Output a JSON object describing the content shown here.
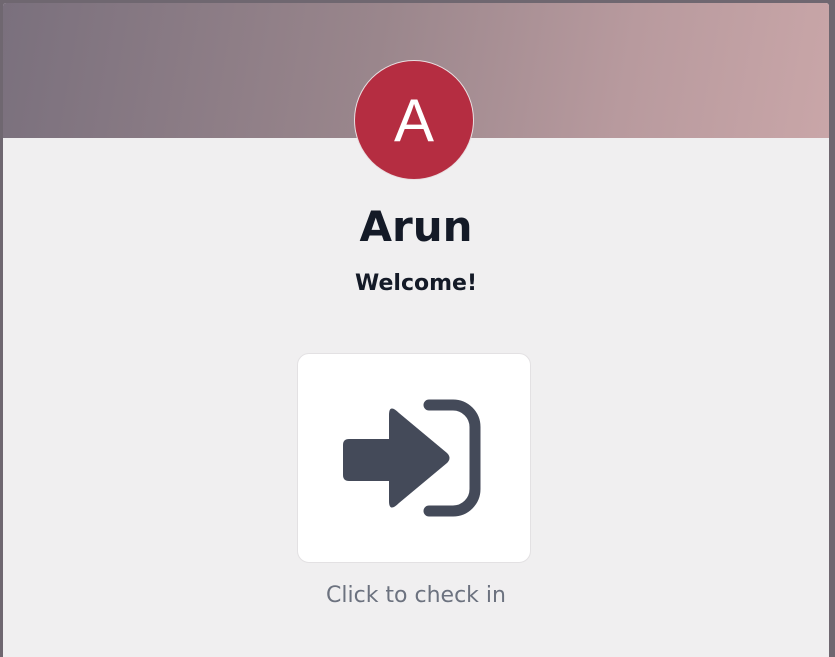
{
  "user": {
    "avatar_letter": "A",
    "name": "Arun",
    "greeting": "Welcome!"
  },
  "checkin": {
    "icon": "sign-in-icon",
    "hint": "Click to check in"
  },
  "colors": {
    "avatar_background": "#b52d41",
    "icon_color": "#444a59",
    "text_primary": "#141a27",
    "text_muted": "#6c727f",
    "page_background": "#f0eff0"
  }
}
